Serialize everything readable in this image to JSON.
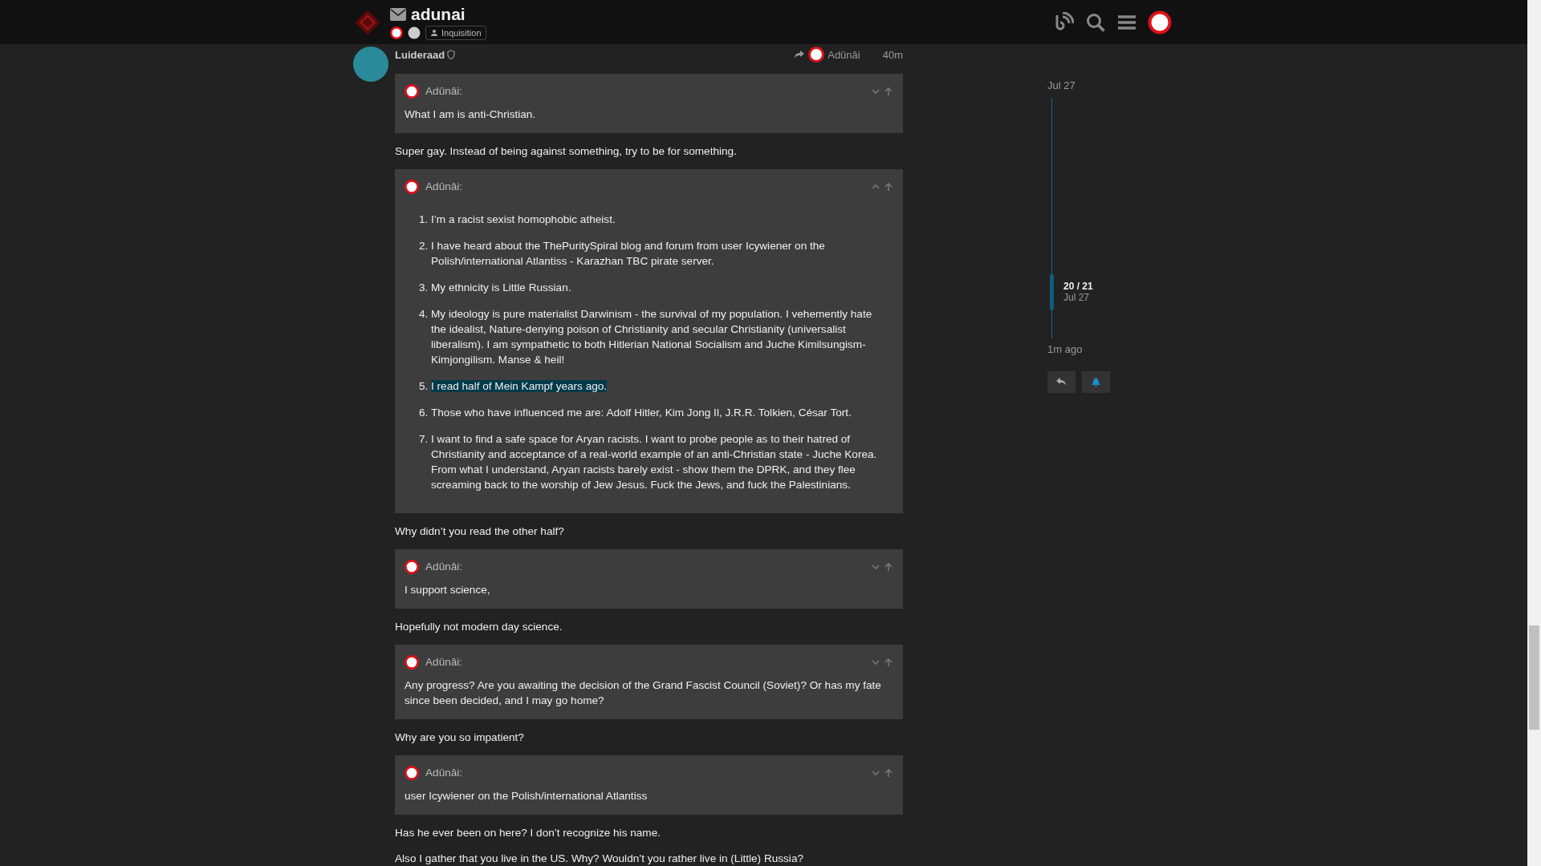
{
  "header": {
    "title": "adunai",
    "group_tag": "Inquisition"
  },
  "post": {
    "username": "Luideraad",
    "reply_to": "Adûnâi",
    "time": "40m",
    "body": [
      {
        "kind": "quote",
        "author": "Adûnâi:",
        "expanded": false,
        "text": "What I am is anti-Christian."
      },
      {
        "kind": "paragraph",
        "text": "Super gay. Instead of being against something, try to be for something."
      },
      {
        "kind": "quote",
        "author": "Adûnâi:",
        "expanded": true,
        "items": [
          {
            "number": "1.",
            "text": "I’m a racist sexist homophobic atheist.",
            "highlighted": false
          },
          {
            "number": "2.",
            "text": "I have heard about the ThePuritySpiral blog and forum from user Icywiener on the Polish/international Atlantiss - Karazhan TBC pirate server.",
            "highlighted": false
          },
          {
            "number": "3.",
            "text": "My ethnicity is Little Russian.",
            "highlighted": false
          },
          {
            "number": "4.",
            "text": "My ideology is pure materialist Darwinism - the survival of my population. I vehemently hate the idealist, Nature-denying poison of Christianity and secular Christianity (universalist liberalism). I am sympathetic to both Hitlerian National Socialism and Juche Kimilsungism-Kimjongilism. Manse & heil!",
            "highlighted": false
          },
          {
            "number": "5.",
            "text": "I read half of Mein Kampf years ago.",
            "highlighted": true
          },
          {
            "number": "6.",
            "text": "Those who have influenced me are: Adolf Hitler, Kim Jong Il, J.R.R. Tolkien, César Tort.",
            "highlighted": false
          },
          {
            "number": "7.",
            "text": "I want to find a safe space for Aryan racists. I want to probe people as to their hatred of Christianity and acceptance of a real-world example of an anti-Christian state - Juche Korea. From what I understand, Aryan racists barely exist - show them the DPRK, and they flee screaming back to the worship of Jew Jesus. Fuck the Jews, and fuck the Palestinians.",
            "highlighted": false
          }
        ]
      },
      {
        "kind": "paragraph",
        "text": "Why didn’t you read the other half?"
      },
      {
        "kind": "quote",
        "author": "Adûnâi:",
        "expanded": false,
        "text": "I support science,"
      },
      {
        "kind": "paragraph",
        "text": "Hopefully not modern day science."
      },
      {
        "kind": "quote",
        "author": "Adûnâi:",
        "expanded": false,
        "text": "Any progress? Are you awaiting the decision of the Grand Fascist Council (Soviet)? Or has my fate since been decided, and I may go home?"
      },
      {
        "kind": "paragraph",
        "text": "Why are you so impatient?"
      },
      {
        "kind": "quote",
        "author": "Adûnâi:",
        "expanded": false,
        "text": "user Icywiener on the Polish/international Atlantiss"
      },
      {
        "kind": "paragraph",
        "text": "Has he ever been on here? I don’t recognize his name."
      },
      {
        "kind": "paragraph",
        "text": "Also I gather that you live in the US. Why? Wouldn’t you rather live in (Little) Russia?"
      }
    ]
  },
  "timeline": {
    "start": "Jul 27",
    "position": "20 / 21",
    "position_date": "Jul 27",
    "end": "1m ago"
  }
}
